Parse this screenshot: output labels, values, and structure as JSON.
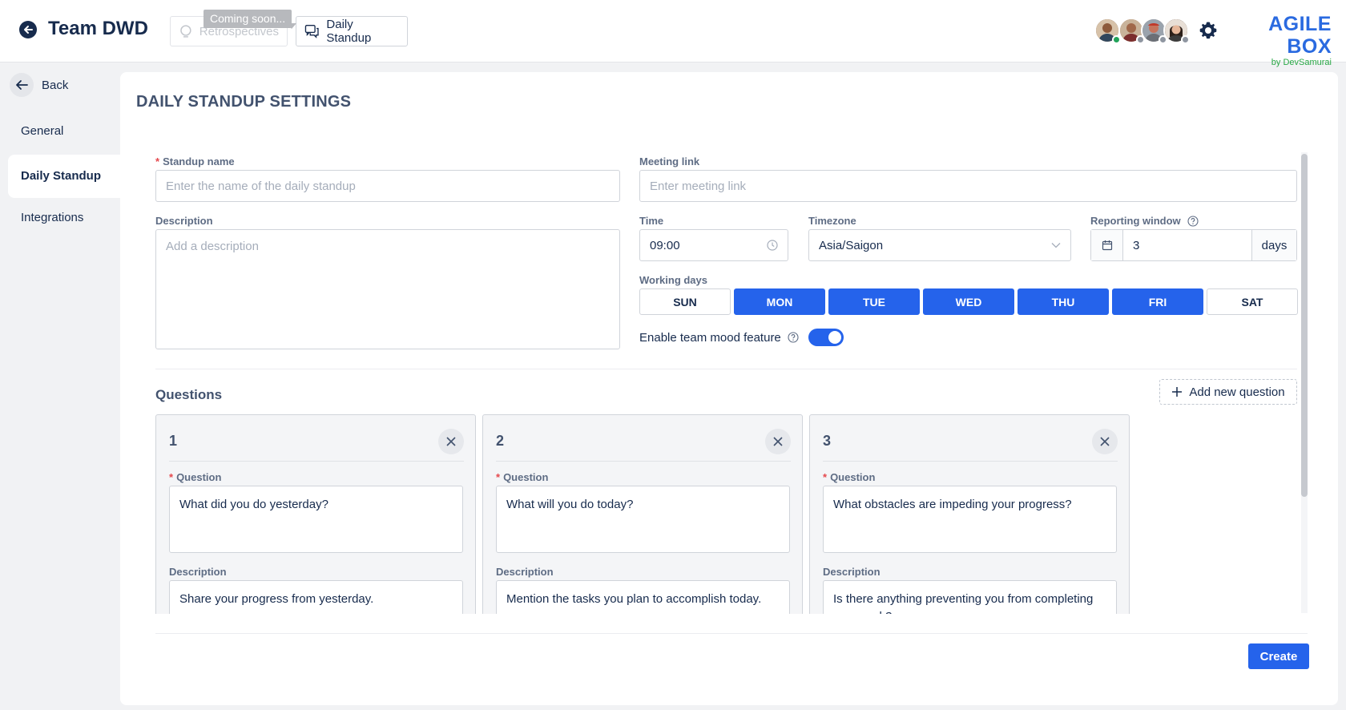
{
  "header": {
    "team_name": "Team DWD",
    "tabs": [
      {
        "label": "Retrospectives",
        "disabled": true
      },
      {
        "label": "Daily Standup",
        "disabled": false
      }
    ],
    "tooltip": "Coming soon...",
    "brand": {
      "name": "AGILE BOX",
      "by": "by DevSamurai"
    }
  },
  "sidebar": {
    "back_label": "Back",
    "items": [
      {
        "label": "General",
        "active": false
      },
      {
        "label": "Daily Standup",
        "active": true
      },
      {
        "label": "Integrations",
        "active": false
      }
    ]
  },
  "form": {
    "page_title": "DAILY STANDUP SETTINGS",
    "standup_name": {
      "label": "Standup name",
      "placeholder": "Enter the name of the daily standup",
      "value": ""
    },
    "meeting_link": {
      "label": "Meeting link",
      "placeholder": "Enter meeting link",
      "value": ""
    },
    "description": {
      "label": "Description",
      "placeholder": "Add a description",
      "value": ""
    },
    "time": {
      "label": "Time",
      "value": "09:00"
    },
    "timezone": {
      "label": "Timezone",
      "value": "Asia/Saigon"
    },
    "reporting_window": {
      "label": "Reporting window",
      "value": "3",
      "unit": "days"
    },
    "working_days": {
      "label": "Working days",
      "days": [
        {
          "label": "SUN",
          "selected": false
        },
        {
          "label": "MON",
          "selected": true
        },
        {
          "label": "TUE",
          "selected": true
        },
        {
          "label": "WED",
          "selected": true
        },
        {
          "label": "THU",
          "selected": true
        },
        {
          "label": "FRI",
          "selected": true
        },
        {
          "label": "SAT",
          "selected": false
        }
      ]
    },
    "mood": {
      "label": "Enable team mood feature",
      "enabled": true
    }
  },
  "questions": {
    "title": "Questions",
    "add_label": "Add new question",
    "question_label": "Question",
    "description_label": "Description",
    "items": [
      {
        "number": "1",
        "question": "What did you do yesterday?",
        "description": "Share your progress from yesterday."
      },
      {
        "number": "2",
        "question": "What will you do today?",
        "description": "Mention the tasks you plan to accomplish today."
      },
      {
        "number": "3",
        "question": "What obstacles are impeding your progress?",
        "description": "Is there anything preventing you from completing your work?"
      }
    ]
  },
  "footer": {
    "create_label": "Create"
  },
  "colors": {
    "accent": "#2563eb",
    "brand": "#2a6ae0",
    "required": "#e5484d"
  }
}
